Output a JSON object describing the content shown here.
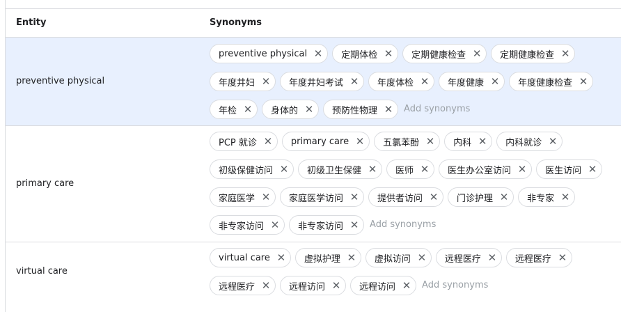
{
  "header": {
    "entity": "Entity",
    "synonyms": "Synonyms"
  },
  "add_placeholder": "Add synonyms",
  "rows": [
    {
      "entity": "preventive physical",
      "synonyms": [
        [
          "preventive physical",
          "定期体检",
          "定期健康检查",
          "定期健康检查"
        ],
        [
          "年度井妇",
          "年度井妇考试",
          "年度体检",
          "年度健康",
          "年度健康检查"
        ],
        [
          "年检",
          "身体的",
          "预防性物理"
        ]
      ]
    },
    {
      "entity": "primary care",
      "synonyms": [
        [
          "PCP 就诊",
          "primary care",
          "五氯苯酚",
          "内科",
          "内科就诊"
        ],
        [
          "初级保健访问",
          "初级卫生保健",
          "医师",
          "医生办公室访问",
          "医生访问"
        ],
        [
          "家庭医学",
          "家庭医学访问",
          "提供者访问",
          "门诊护理",
          "非专家"
        ],
        [
          "非专家访问",
          "非专家访问"
        ]
      ]
    },
    {
      "entity": "virtual care",
      "synonyms": [
        [
          "virtual care",
          "虚拟护理",
          "虚拟访问",
          "远程医疗",
          "远程医疗"
        ],
        [
          "远程医疗",
          "远程访问",
          "远程访问"
        ]
      ]
    }
  ]
}
